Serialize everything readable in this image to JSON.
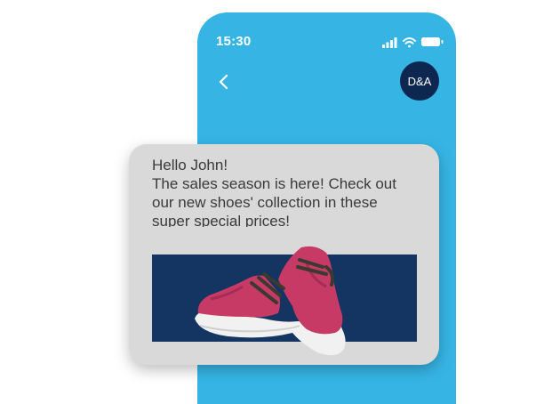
{
  "status_bar": {
    "time": "15:30"
  },
  "header": {
    "avatar_initials": "D&A"
  },
  "message": {
    "greeting": "Hello John!",
    "body": "The sales season is here! Check out our new shoes' collection in these super special prices!"
  },
  "icons": {
    "back": "chevron-left-icon",
    "signal": "signal-icon",
    "wifi": "wifi-icon",
    "battery": "battery-icon",
    "promo": "sneaker-image"
  },
  "colors": {
    "phone_background": "#36b5e5",
    "avatar_background": "#0d2750",
    "bubble_background": "#d9d9d9",
    "promo_background": "#143462",
    "shoe": "#c73a66"
  }
}
